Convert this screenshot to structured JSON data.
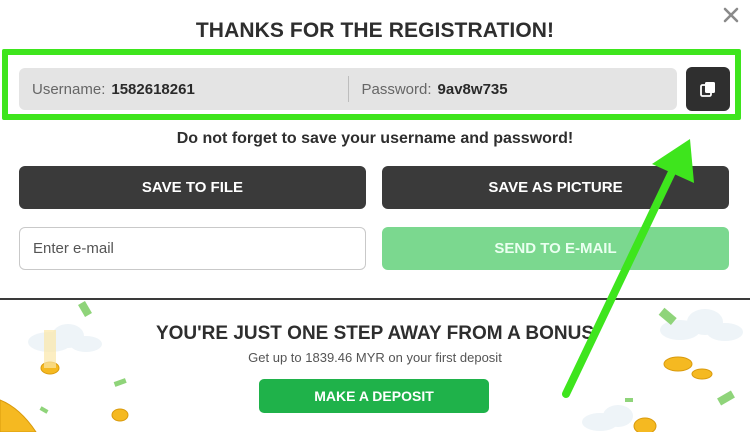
{
  "dialog": {
    "title": "THANKS FOR THE REGISTRATION!",
    "close_icon": "close-icon",
    "credentials": {
      "username_label": "Username:",
      "username_value": "1582618261",
      "password_label": "Password:",
      "password_value": "9av8w735",
      "copy_icon": "copy-icon"
    },
    "note": "Do not forget to save your username and password!",
    "save_to_file_label": "SAVE TO FILE",
    "save_as_picture_label": "SAVE AS PICTURE",
    "email": {
      "value": "",
      "placeholder": "Enter e-mail"
    },
    "send_to_email_label": "SEND TO E-MAIL"
  },
  "bonus": {
    "title": "YOU'RE JUST ONE STEP AWAY FROM A BONUS",
    "subtitle": "Get up to 1839.46 MYR on your first deposit",
    "deposit_label": "MAKE A DEPOSIT"
  },
  "colors": {
    "highlight": "#3ee51d",
    "dark_button": "#3a3a3a",
    "send_button": "#7bd88f",
    "deposit_button": "#1fb24a",
    "coin": "#f5b921"
  }
}
